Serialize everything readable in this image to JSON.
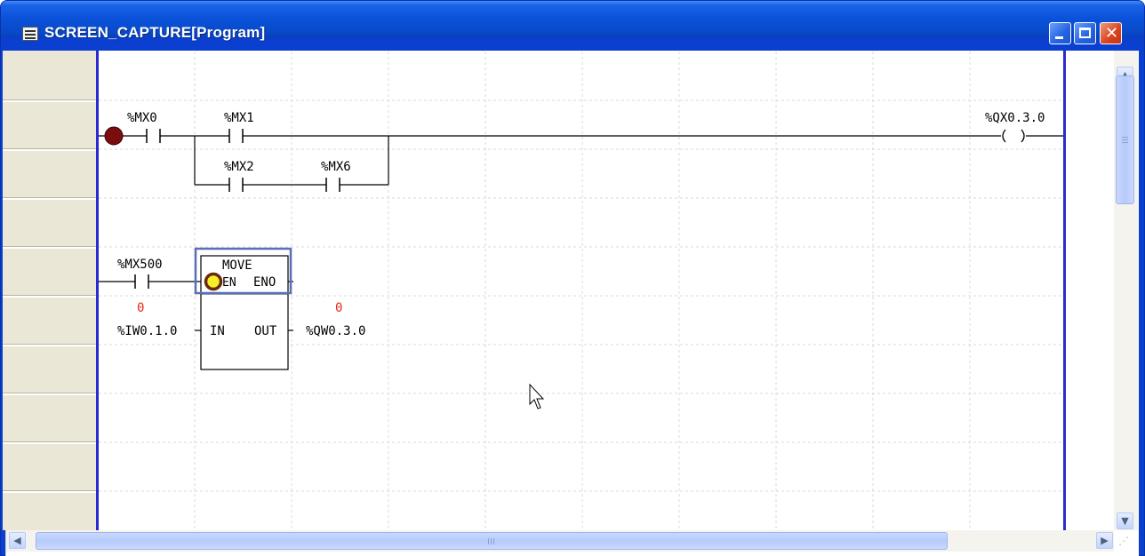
{
  "window": {
    "title": "SCREEN_CAPTURE[Program]",
    "icon": "ladder-program-icon",
    "buttons": {
      "minimize": "minimize-icon",
      "maximize": "maximize-icon",
      "close": "✕"
    }
  },
  "rung1": {
    "contacts": [
      {
        "address": "%MX0"
      },
      {
        "address": "%MX1"
      },
      {
        "address": "%MX2"
      },
      {
        "address": "%MX6"
      }
    ],
    "coil": {
      "address": "%QX0.3.0"
    }
  },
  "rung2": {
    "contact": {
      "address": "%MX500",
      "value": "0"
    },
    "function_block": {
      "name": "MOVE",
      "in_en": "EN",
      "out_eno": "ENO",
      "in_pin": "IN",
      "out_pin": "OUT"
    },
    "input_var": "%IW0.1.0",
    "output_var": "%QW0.3.0",
    "output_value": "0"
  },
  "colors": {
    "rail": "#2a2ad0",
    "breakpoint": "#7a0d0d",
    "monitor_value": "#e8251c",
    "selection": "#5a6fb8",
    "title_bar": "#0b52da"
  }
}
